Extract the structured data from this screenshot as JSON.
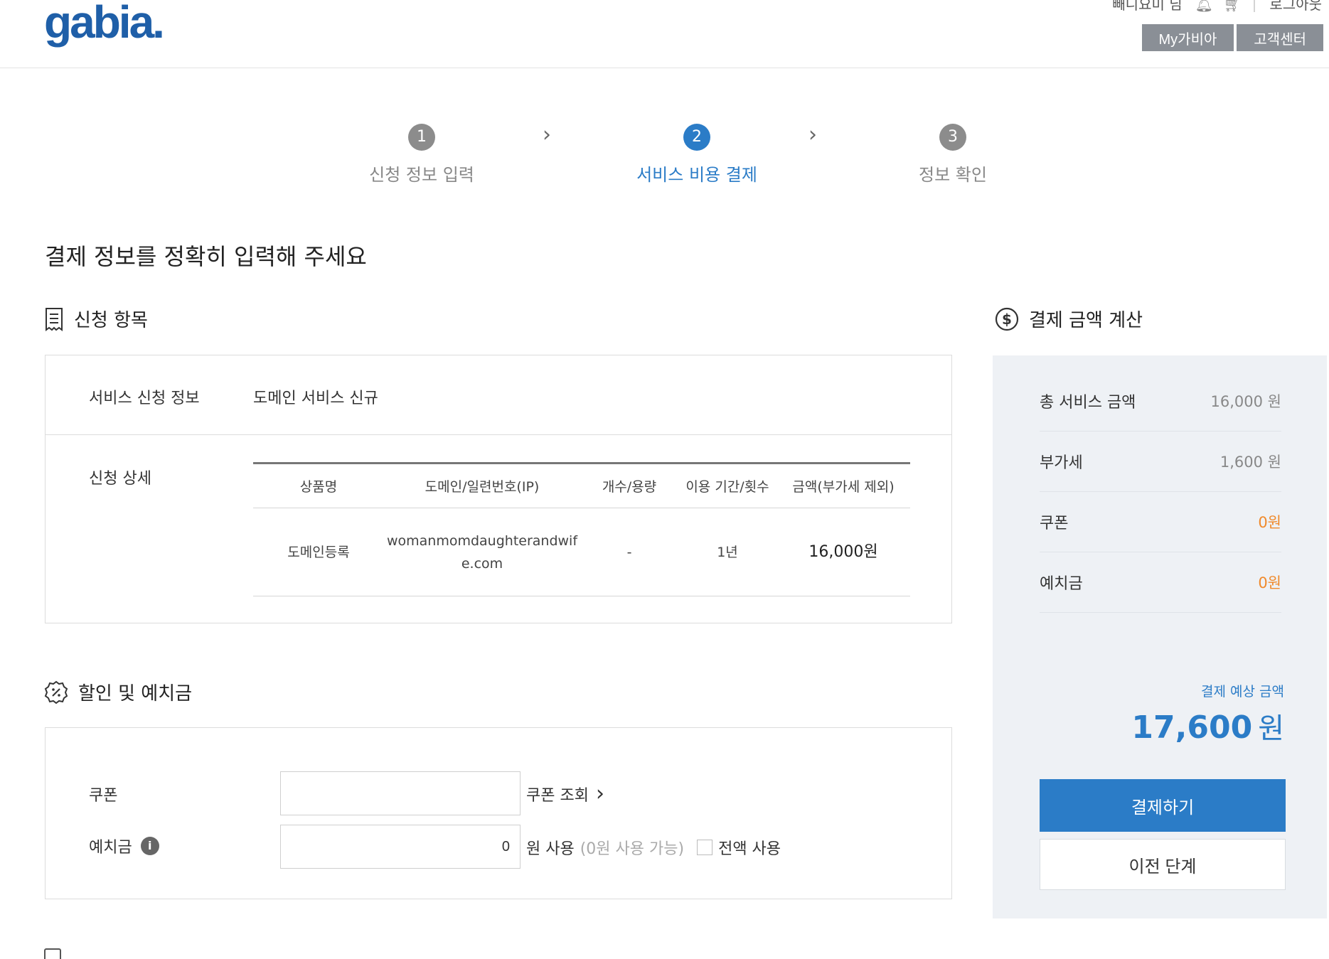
{
  "header": {
    "logo": "gabia",
    "logo_dot": ".",
    "user_name": "빼니요미 님",
    "logout": "로그아웃",
    "my_gabia": "My가비아",
    "customer_center": "고객센터"
  },
  "steps": [
    {
      "num": "1",
      "label": "신청 정보 입력"
    },
    {
      "num": "2",
      "label": "서비스 비용 결제"
    },
    {
      "num": "3",
      "label": "정보 확인"
    }
  ],
  "page_title": "결제 정보를 정확히 입력해 주세요",
  "apply_section": {
    "title": "신청 항목",
    "service_info_label": "서비스 신청 정보",
    "service_info_value": "도메인 서비스 신규",
    "detail_label": "신청 상세",
    "table": {
      "headers": [
        "상품명",
        "도메인/일련번호(IP)",
        "개수/용량",
        "이용 기간/횟수",
        "금액(부가세 제외)"
      ],
      "rows": [
        {
          "product": "도메인등록",
          "domain_line1": "womanmomdaughterandwif",
          "domain_line2": "e.com",
          "count": "-",
          "period": "1년",
          "amount": "16,000원"
        }
      ]
    }
  },
  "discount_section": {
    "title": "할인 및 예치금",
    "coupon_label": "쿠폰",
    "coupon_value": "",
    "coupon_lookup": "쿠폰 조회",
    "deposit_label": "예치금",
    "deposit_value": "0",
    "deposit_unit": "원 사용",
    "deposit_available": "(0원 사용 가능)",
    "use_all": "전액 사용"
  },
  "calc_section": {
    "title": "결제 금액 계산",
    "rows": [
      {
        "label": "총 서비스 금액",
        "value": "16,000 원"
      },
      {
        "label": "부가세",
        "value": "1,600 원"
      },
      {
        "label": "쿠폰",
        "value": "0원"
      },
      {
        "label": "예치금",
        "value": "0원"
      }
    ],
    "estimate_label": "결제 예상 금액",
    "estimate_amount": "17,600",
    "estimate_unit": "원",
    "pay_button": "결제하기",
    "prev_button": "이전 단계",
    "highlight_color": "#f08a2c",
    "accent_color": "#2b7cc7"
  }
}
